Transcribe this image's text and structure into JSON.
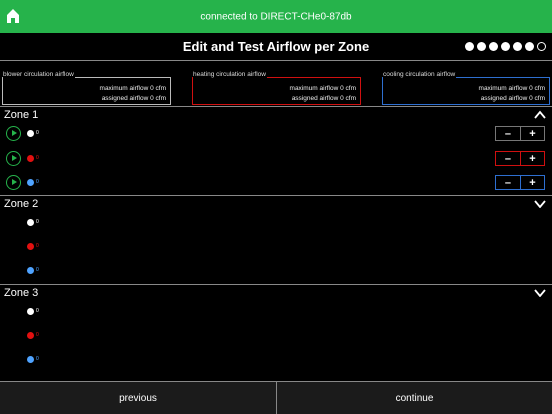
{
  "status_bar": {
    "connection_text": "connected to DIRECT-CHe0-87db"
  },
  "header": {
    "title": "Edit and Test Airflow per Zone",
    "progress": {
      "total": 7,
      "current": 6
    }
  },
  "circulation": [
    {
      "label": "blower circulation airflow",
      "max_text": "maximum airflow 0 cfm",
      "assigned_text": "assigned airflow 0 cfm",
      "color": "#bbbbbb"
    },
    {
      "label": "heating circulation airflow",
      "max_text": "maximum airflow 0 cfm",
      "assigned_text": "assigned airflow 0 cfm",
      "color": "#d01010"
    },
    {
      "label": "cooling circulation airflow",
      "max_text": "maximum airflow 0 cfm",
      "assigned_text": "assigned airflow 0 cfm",
      "color": "#2e6fd0"
    }
  ],
  "zones": [
    {
      "name": "Zone 1",
      "expanded": true,
      "values": [
        "0",
        "0",
        "0"
      ]
    },
    {
      "name": "Zone 2",
      "expanded": false,
      "values": [
        "0",
        "0",
        "0"
      ]
    },
    {
      "name": "Zone 3",
      "expanded": false,
      "values": [
        "0",
        "0",
        "0"
      ]
    }
  ],
  "stepper": {
    "minus": "–",
    "plus": "+"
  },
  "footer": {
    "previous_label": "previous",
    "continue_label": "continue"
  },
  "colors": {
    "status_green": "#26b34b",
    "blower_white": "#ffffff",
    "heating_red": "#e21010",
    "cooling_blue": "#4fa3ff"
  },
  "icons": {
    "home": "home-icon",
    "play": "play-icon",
    "chevron_up": "chevron-up-icon",
    "chevron_down": "chevron-down-icon"
  }
}
